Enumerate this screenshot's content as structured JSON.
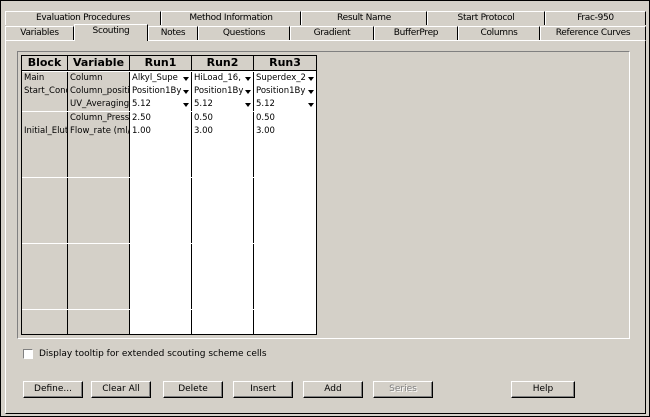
{
  "tabs_back": [
    "Evaluation Procedures",
    "Method Information",
    "Result Name",
    "Start Protocol",
    "Frac-950"
  ],
  "tabs_front": [
    "Variables",
    "Scouting",
    "Notes",
    "Questions",
    "Gradient",
    "BufferPrep",
    "Columns",
    "Reference Curves"
  ],
  "selected_tab": "Scouting",
  "grid": {
    "headers": [
      "Block",
      "Variable",
      "Run1",
      "Run2",
      "Run3"
    ],
    "rows": [
      {
        "block": "Main",
        "variable": "Column",
        "run1": "Alkyl_Supe",
        "run2": "HiLoad_16,",
        "run3": "Superdex_2",
        "dropdown": true
      },
      {
        "block": "Start_Cond",
        "variable": "Column_positio",
        "run1": "Position1By",
        "run2": "Position1By",
        "run3": "Position1By",
        "dropdown": true
      },
      {
        "block": "",
        "variable": "UV_Averaging",
        "run1": "5.12",
        "run2": "5.12",
        "run3": "5.12",
        "dropdown": true
      },
      {
        "block": "",
        "variable": "Column_Pressu",
        "run1": "2.50",
        "run2": "0.50",
        "run3": "0.50",
        "dropdown": false
      },
      {
        "block": "Initial_Eluti",
        "variable": "Flow_rate (ml/",
        "run1": "1.00",
        "run2": "3.00",
        "run3": "3.00",
        "dropdown": false
      }
    ],
    "empty_rows": 15
  },
  "checkbox": {
    "label": "Display tooltip for extended scouting scheme cells",
    "checked": false
  },
  "buttons": {
    "define": "Define...",
    "clear_all": "Clear All",
    "delete": "Delete",
    "insert": "Insert",
    "add": "Add",
    "series": "Series",
    "help": "Help"
  }
}
